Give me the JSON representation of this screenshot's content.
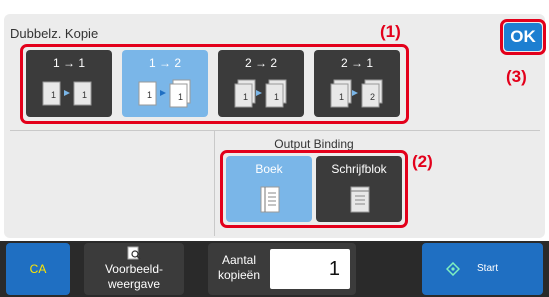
{
  "title": "Dubbelz. Kopie",
  "callouts": {
    "one": "(1)",
    "two": "(2)",
    "three": "(3)"
  },
  "ok_label": "OK",
  "copy_modes": [
    {
      "label": "1 → 1",
      "selected": false
    },
    {
      "label": "1 → 2",
      "selected": true
    },
    {
      "label": "2 → 2",
      "selected": false
    },
    {
      "label": "2 → 1",
      "selected": false
    }
  ],
  "output_binding": {
    "label": "Output Binding",
    "options": [
      {
        "label": "Boek",
        "selected": true
      },
      {
        "label": "Schrijfblok",
        "selected": false
      }
    ]
  },
  "bottom_bar": {
    "ca_label": "CA",
    "preview_line1": "Voorbeeld-",
    "preview_line2": "weergave",
    "copies_line1": "Aantal",
    "copies_line2": "kopieën",
    "copies_value": "1",
    "start_label": "Start"
  },
  "colors": {
    "accent_red": "#e3001b",
    "selected_blue": "#7ab6e8",
    "primary_blue": "#1f6fc2",
    "ca_text": "#ffe600"
  }
}
